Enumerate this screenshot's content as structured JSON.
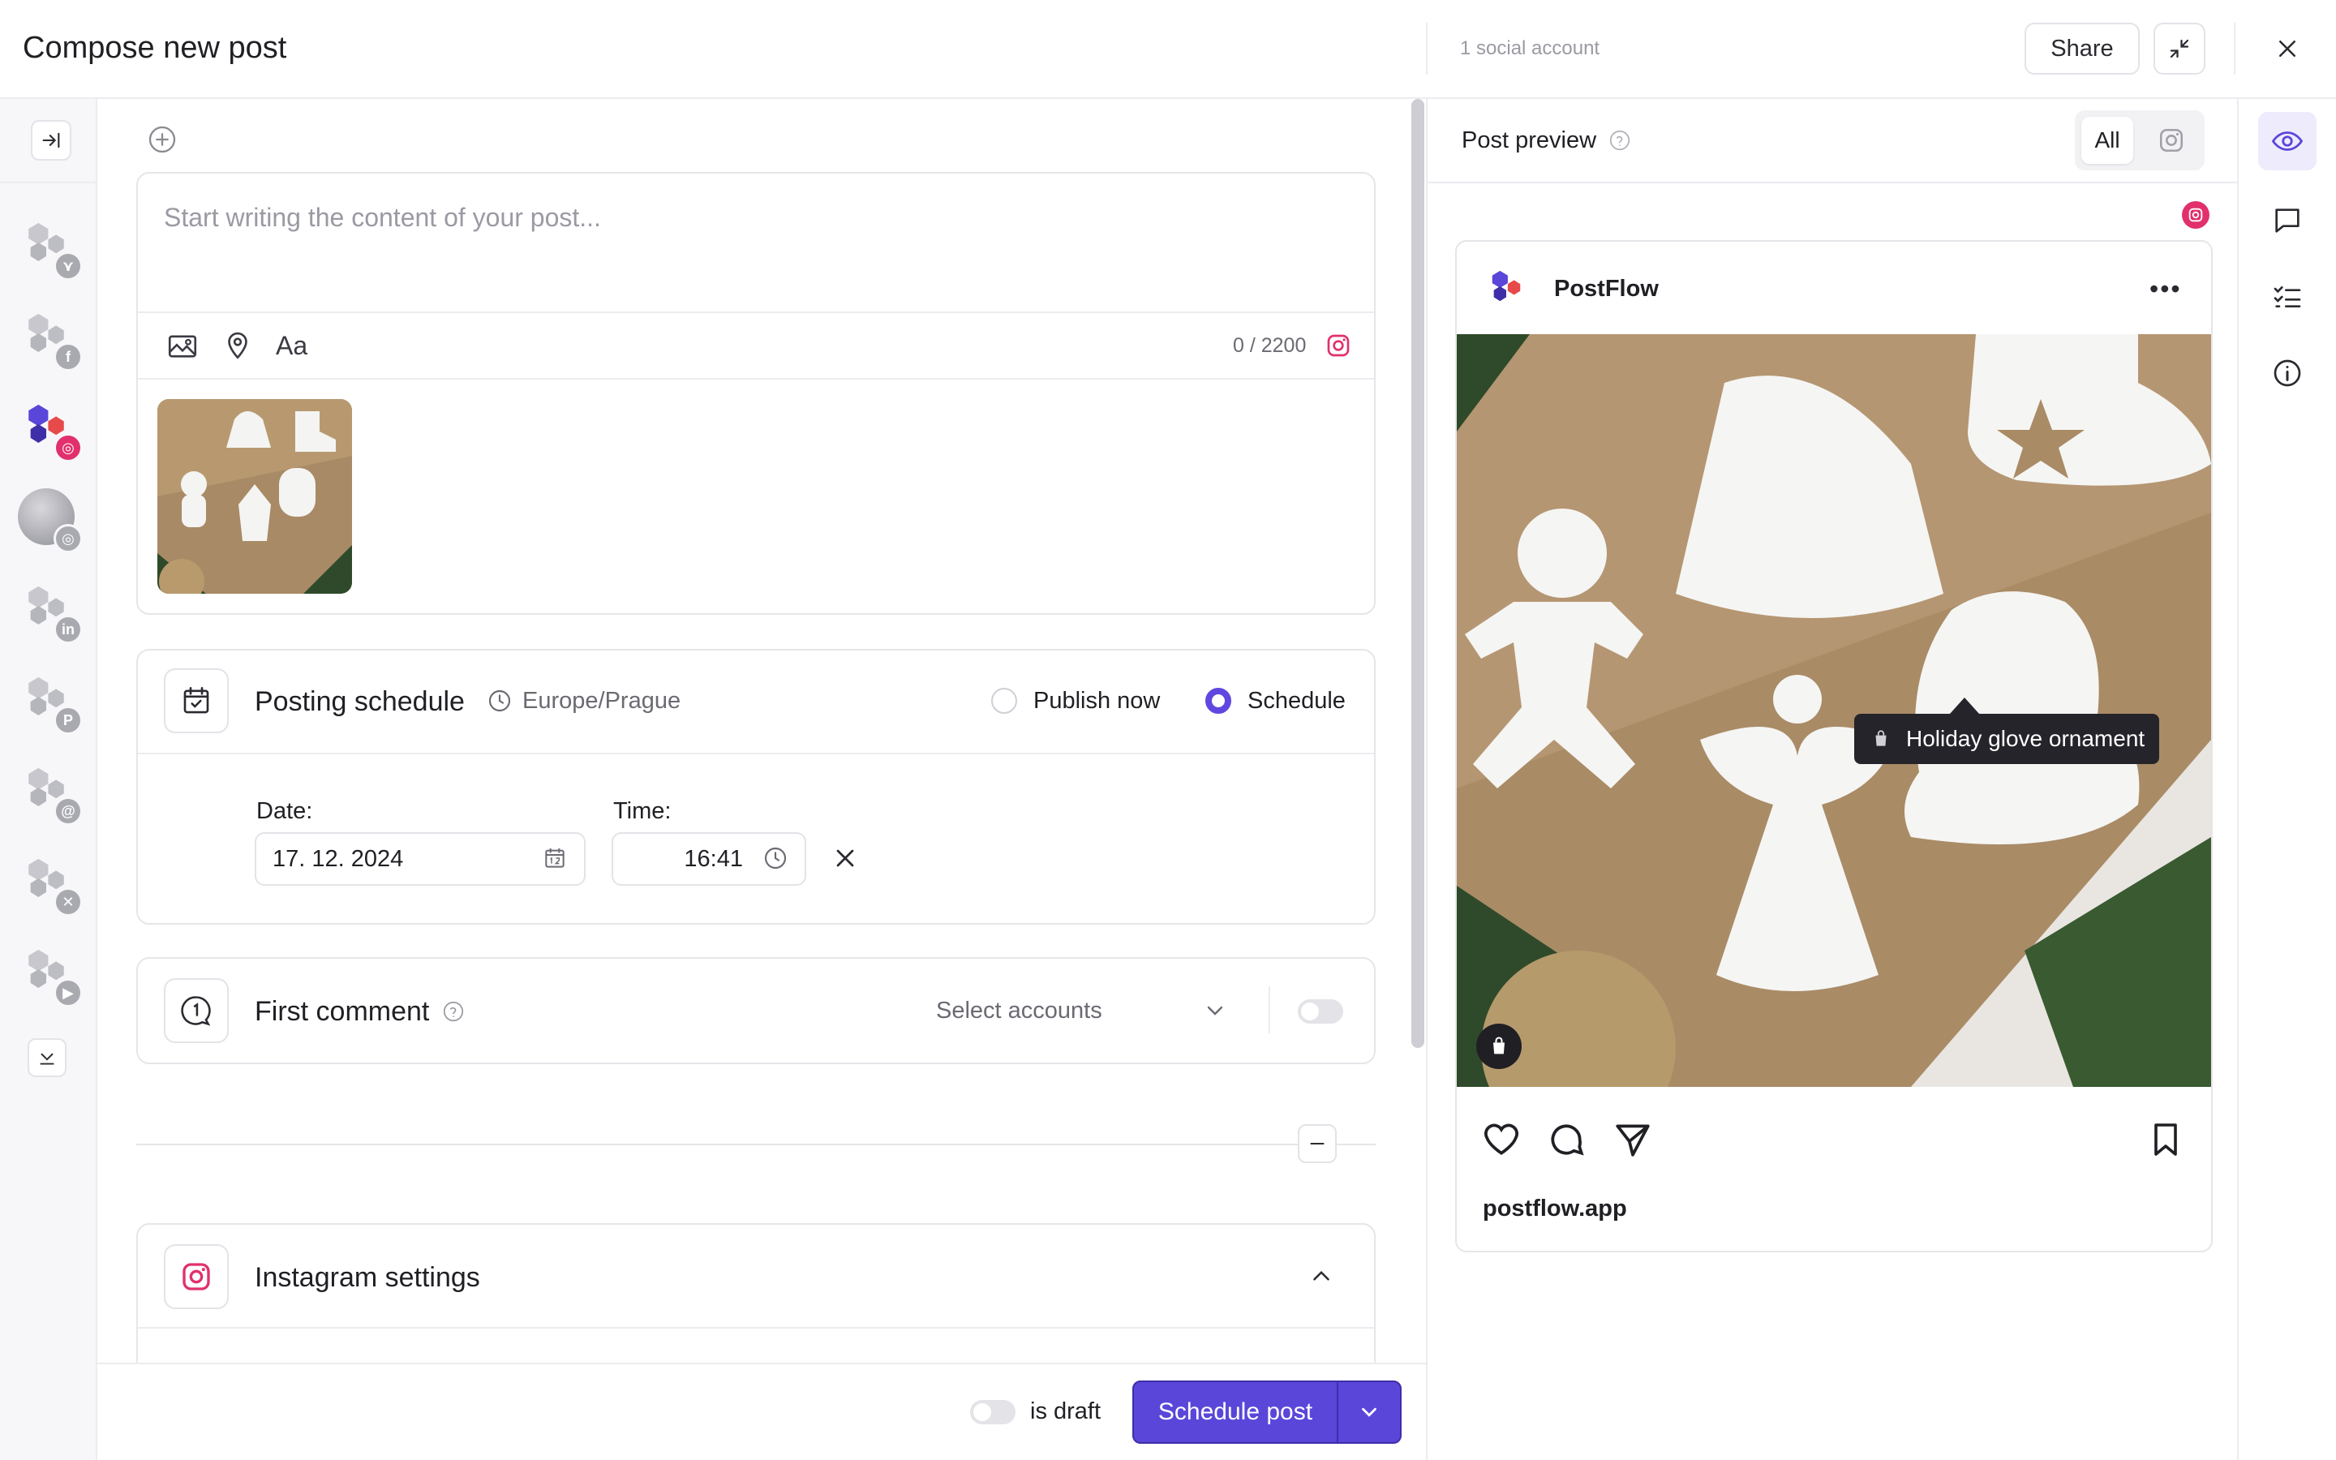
{
  "header": {
    "title": "Compose new post",
    "accounts_count": "1 social account",
    "share_label": "Share"
  },
  "left_rail": {
    "accounts": [
      {
        "network": "bluesky",
        "badge": "butterfly-icon",
        "selected": false
      },
      {
        "network": "facebook",
        "badge": "facebook-icon",
        "selected": false
      },
      {
        "network": "instagram",
        "badge": "instagram-icon",
        "selected": true
      },
      {
        "network": "instagram-avatar",
        "badge": "instagram-icon",
        "selected": false
      },
      {
        "network": "linkedin",
        "badge": "linkedin-icon",
        "selected": false
      },
      {
        "network": "pinterest",
        "badge": "pinterest-icon",
        "selected": false
      },
      {
        "network": "threads",
        "badge": "threads-icon",
        "selected": false
      },
      {
        "network": "x",
        "badge": "x-icon",
        "selected": false
      },
      {
        "network": "youtube",
        "badge": "play-icon",
        "selected": false
      }
    ]
  },
  "editor": {
    "placeholder": "Start writing the content of your post...",
    "counter": "0 / 2200"
  },
  "schedule": {
    "title": "Posting schedule",
    "timezone": "Europe/Prague",
    "publish_now_label": "Publish now",
    "schedule_label": "Schedule",
    "selected": "schedule",
    "date_label": "Date:",
    "date_value": "17. 12. 2024",
    "time_label": "Time:",
    "time_value": "16:41"
  },
  "first_comment": {
    "title": "First comment",
    "select_placeholder": "Select accounts",
    "enabled": false
  },
  "instagram_settings": {
    "title": "Instagram settings"
  },
  "footer": {
    "draft_label": "is draft",
    "draft_enabled": false,
    "schedule_button": "Schedule post"
  },
  "preview": {
    "title": "Post preview",
    "tab_all": "All",
    "account_name": "PostFlow",
    "product_tag": "Holiday glove ornament",
    "website": "postflow.app"
  },
  "colors": {
    "accent": "#5a46d9",
    "instagram": "#e1306c",
    "badge_gray": "#a9a9b0"
  }
}
